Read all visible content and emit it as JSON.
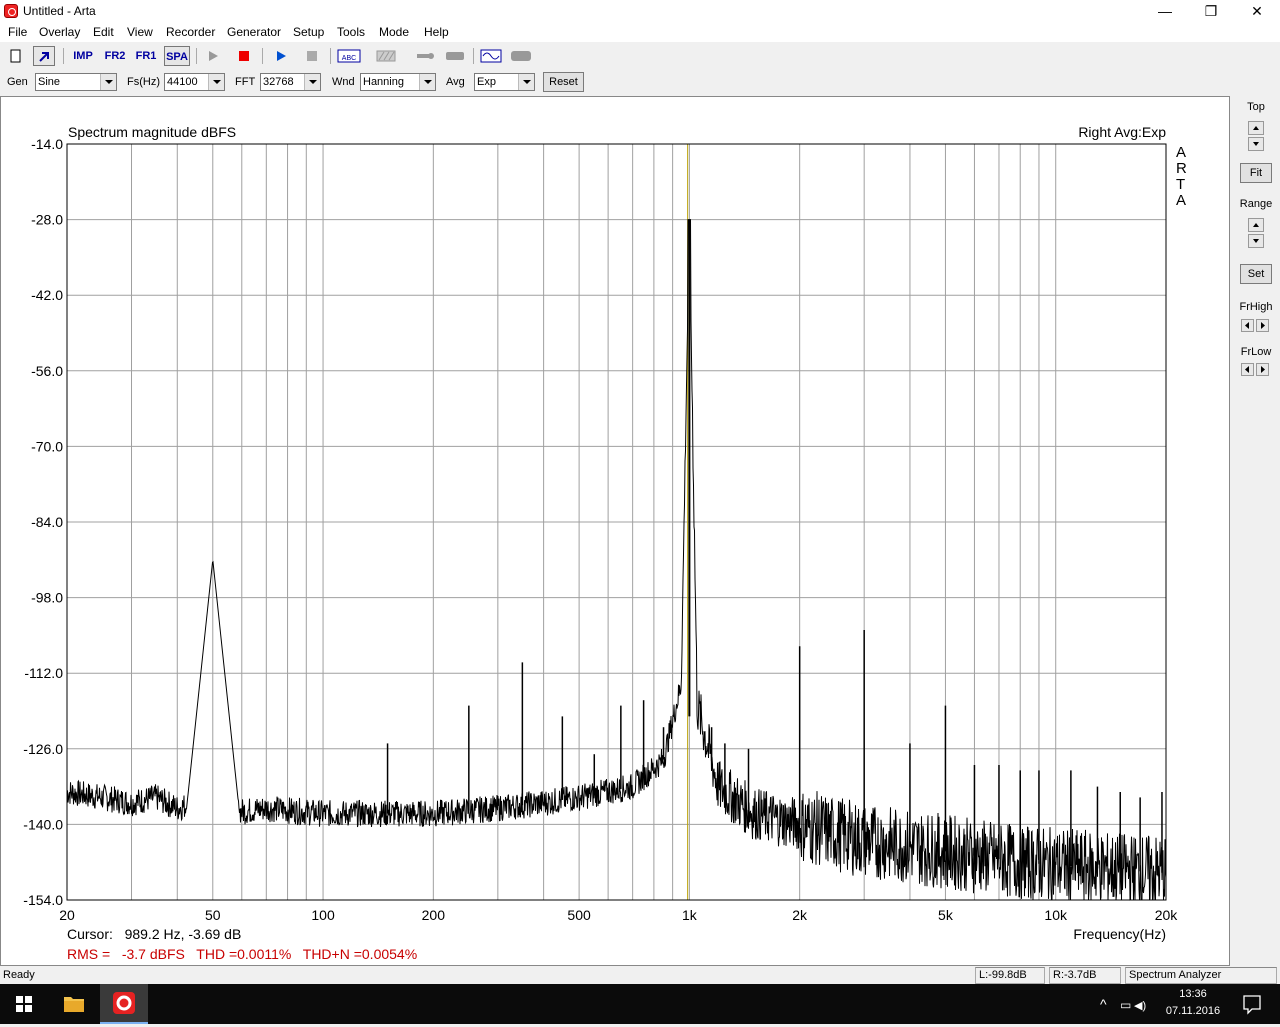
{
  "window": {
    "title": "Untitled - Arta",
    "min": "—",
    "max": "❐",
    "close": "✕"
  },
  "menu": [
    "File",
    "Overlay",
    "Edit",
    "View",
    "Recorder",
    "Generator",
    "Setup",
    "Tools",
    "Mode",
    "Help"
  ],
  "toolbar": {
    "imp": "IMP",
    "fr2": "FR2",
    "fr1": "FR1",
    "spa": "SPA",
    "abc": "ABC"
  },
  "params": {
    "gen_label": "Gen",
    "gen_value": "Sine",
    "fs_label": "Fs(Hz)",
    "fs_value": "44100",
    "fft_label": "FFT",
    "fft_value": "32768",
    "wnd_label": "Wnd",
    "wnd_value": "Hanning",
    "avg_label": "Avg",
    "avg_value": "Exp",
    "reset_label": "Reset"
  },
  "side": {
    "top_label": "Top",
    "fit_label": "Fit",
    "range_label": "Range",
    "set_label": "Set",
    "frhigh_label": "FrHigh",
    "frlow_label": "FrLow"
  },
  "plot": {
    "title": "Spectrum magnitude dBFS",
    "right_title": "Right Avg:Exp",
    "brand": "ARTA",
    "xlabel": "Frequency(Hz)",
    "cursor_text": "Cursor:   989.2 Hz, -3.69 dB",
    "measure_text": "RMS =   -3.7 dBFS   THD =0.0011%   THD+N =0.0054%",
    "colors": {
      "trace": "#000000",
      "cursor": "#b8a000",
      "grid": "#a0a0a0",
      "measure": "#c80000"
    }
  },
  "chart_data": {
    "type": "line",
    "title": "Spectrum magnitude dBFS",
    "xlabel": "Frequency(Hz)",
    "ylabel": "",
    "xscale": "log",
    "xlim": [
      20,
      20000
    ],
    "ylim": [
      -154,
      -14
    ],
    "yticks": [
      "-14.0",
      "-28.0",
      "-42.0",
      "-56.0",
      "-70.0",
      "-84.0",
      "-98.0",
      "-112.0",
      "-126.0",
      "-140.0",
      "-154.0"
    ],
    "xticks": [
      {
        "label": "20",
        "value": 20
      },
      {
        "label": "50",
        "value": 50
      },
      {
        "label": "100",
        "value": 100
      },
      {
        "label": "200",
        "value": 200
      },
      {
        "label": "500",
        "value": 500
      },
      {
        "label": "1k",
        "value": 1000
      },
      {
        "label": "2k",
        "value": 2000
      },
      {
        "label": "5k",
        "value": 5000
      },
      {
        "label": "10k",
        "value": 10000
      },
      {
        "label": "20k",
        "value": 20000
      }
    ],
    "cursor_hz": 989.2,
    "floor": [
      {
        "x": 20,
        "y": -134
      },
      {
        "x": 25,
        "y": -135
      },
      {
        "x": 30,
        "y": -136
      },
      {
        "x": 35,
        "y": -135
      },
      {
        "x": 40,
        "y": -137
      },
      {
        "x": 45,
        "y": -136
      },
      {
        "x": 55,
        "y": -138
      },
      {
        "x": 70,
        "y": -137
      },
      {
        "x": 100,
        "y": -138
      },
      {
        "x": 150,
        "y": -138
      },
      {
        "x": 200,
        "y": -138
      },
      {
        "x": 300,
        "y": -137
      },
      {
        "x": 400,
        "y": -136
      },
      {
        "x": 500,
        "y": -135
      },
      {
        "x": 700,
        "y": -133
      },
      {
        "x": 850,
        "y": -128
      },
      {
        "x": 950,
        "y": -114
      },
      {
        "x": 1000,
        "y": -28
      },
      {
        "x": 1050,
        "y": -118
      },
      {
        "x": 1200,
        "y": -133
      },
      {
        "x": 1500,
        "y": -138
      },
      {
        "x": 2000,
        "y": -140
      },
      {
        "x": 3000,
        "y": -143
      },
      {
        "x": 5000,
        "y": -145
      },
      {
        "x": 8000,
        "y": -147
      },
      {
        "x": 12000,
        "y": -148
      },
      {
        "x": 20000,
        "y": -149
      }
    ],
    "hum_peak": {
      "x": 50,
      "y": -91
    },
    "harmonic_spikes": [
      {
        "x": 150,
        "y": -125
      },
      {
        "x": 250,
        "y": -118
      },
      {
        "x": 350,
        "y": -110
      },
      {
        "x": 450,
        "y": -120
      },
      {
        "x": 550,
        "y": -127
      },
      {
        "x": 650,
        "y": -118
      },
      {
        "x": 750,
        "y": -117
      },
      {
        "x": 850,
        "y": -122
      },
      {
        "x": 1150,
        "y": -122
      },
      {
        "x": 1250,
        "y": -125
      },
      {
        "x": 1450,
        "y": -126
      },
      {
        "x": 2000,
        "y": -107
      },
      {
        "x": 3000,
        "y": -104
      },
      {
        "x": 4000,
        "y": -125
      },
      {
        "x": 5000,
        "y": -118
      },
      {
        "x": 6000,
        "y": -129
      },
      {
        "x": 7000,
        "y": -129
      },
      {
        "x": 8000,
        "y": -130
      },
      {
        "x": 9000,
        "y": -130
      },
      {
        "x": 11000,
        "y": -130
      },
      {
        "x": 13000,
        "y": -133
      },
      {
        "x": 15000,
        "y": -134
      },
      {
        "x": 17000,
        "y": -135
      },
      {
        "x": 19500,
        "y": -134
      }
    ]
  },
  "status": {
    "ready": "Ready",
    "left": "L:-99.8dB",
    "right": "R:-3.7dB",
    "mode": "Spectrum Analyzer"
  },
  "taskbar": {
    "time": "13:36",
    "date": "07.11.2016",
    "chevron": "^",
    "speaker": "◀)",
    "monitor": "▭"
  }
}
